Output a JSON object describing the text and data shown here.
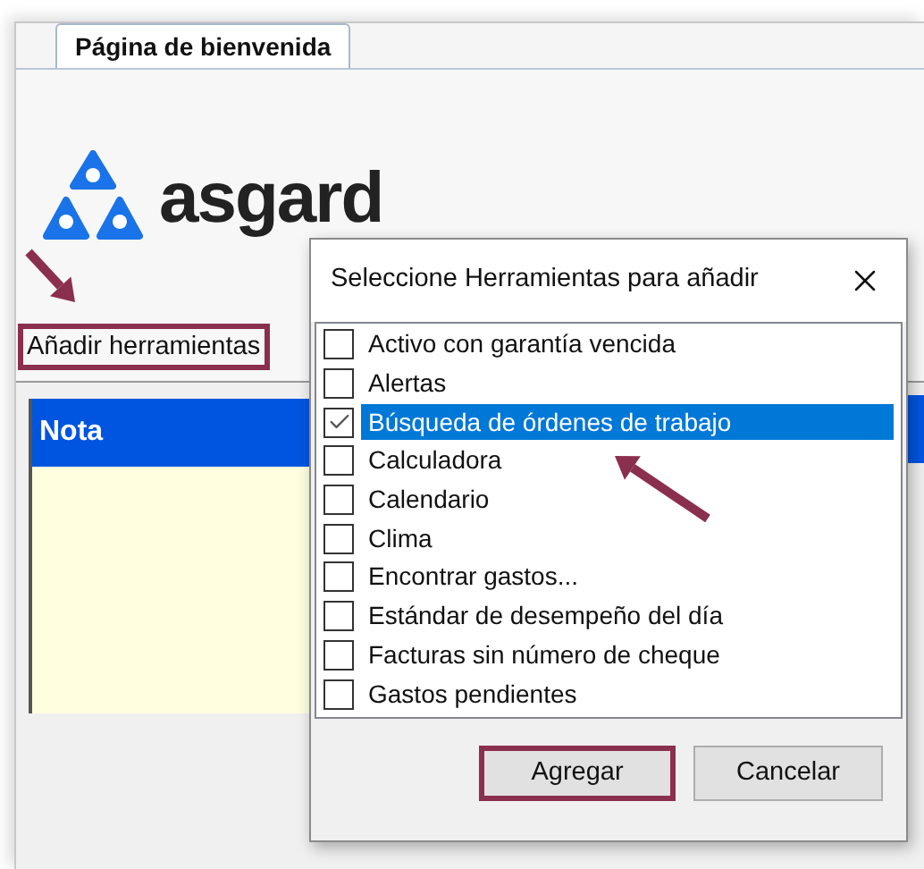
{
  "tab": {
    "label": "Página de bienvenida",
    "selected": true
  },
  "logo": {
    "text": "asgard"
  },
  "add_tools_button": {
    "label": "Añadir herramientas",
    "highlighted": true
  },
  "note_panel": {
    "header": "Nota"
  },
  "dialog": {
    "title": "Seleccione Herramientas para añadir",
    "items": [
      {
        "label": "Activo con garantía vencida",
        "checked": false,
        "selected": false
      },
      {
        "label": "Alertas",
        "checked": false,
        "selected": false
      },
      {
        "label": "Búsqueda de órdenes de trabajo",
        "checked": true,
        "selected": true
      },
      {
        "label": "Calculadora",
        "checked": false,
        "selected": false
      },
      {
        "label": "Calendario",
        "checked": false,
        "selected": false
      },
      {
        "label": "Clima",
        "checked": false,
        "selected": false
      },
      {
        "label": "Encontrar gastos...",
        "checked": false,
        "selected": false
      },
      {
        "label": "Estándar de desempeño del día",
        "checked": false,
        "selected": false
      },
      {
        "label": "Facturas sin número de cheque",
        "checked": false,
        "selected": false
      },
      {
        "label": "Gastos pendientes",
        "checked": false,
        "selected": false
      }
    ],
    "buttons": [
      {
        "label": "Agregar",
        "highlighted": true
      },
      {
        "label": "Cancelar",
        "highlighted": false
      }
    ]
  }
}
